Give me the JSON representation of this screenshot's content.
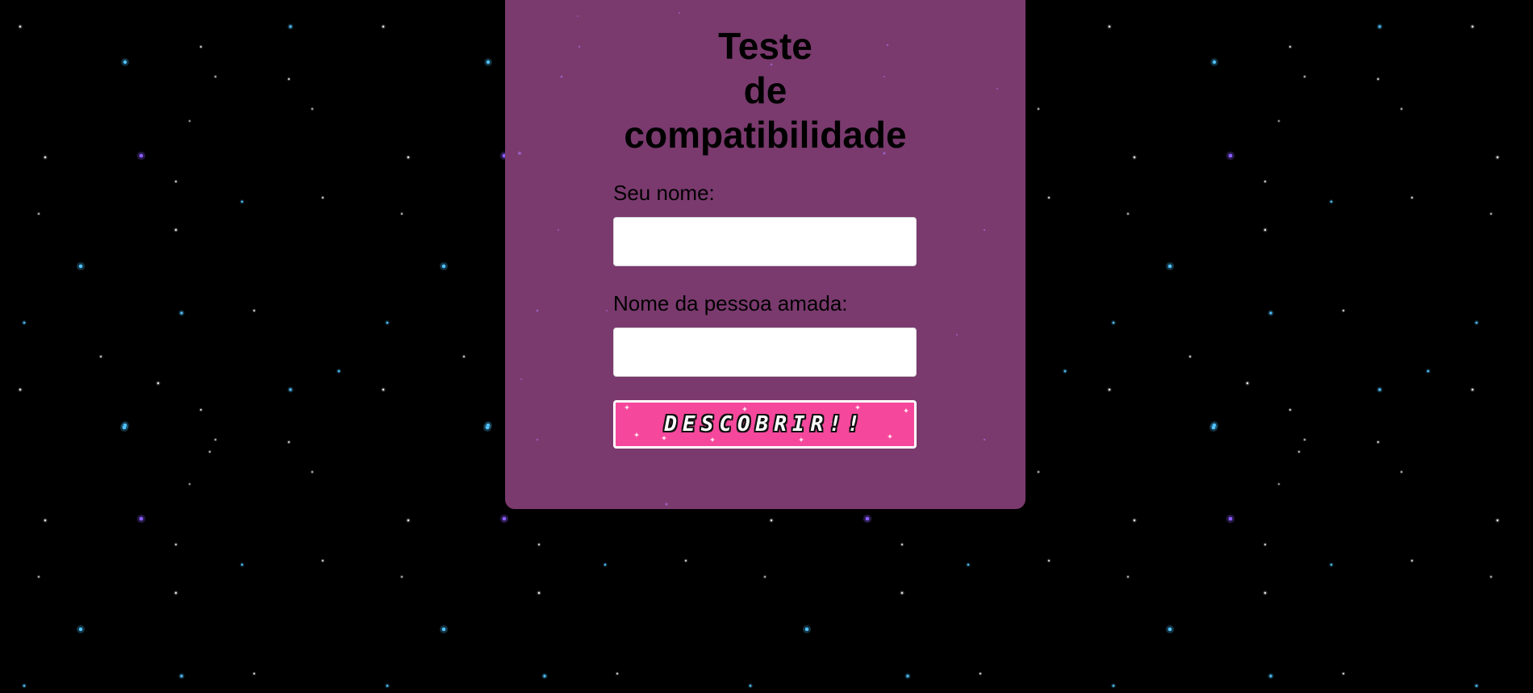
{
  "page": {
    "title_lines": [
      "Teste",
      "de",
      "compatibilidade"
    ]
  },
  "form": {
    "your_name": {
      "label": "Seu nome:",
      "value": "",
      "placeholder": ""
    },
    "loved_name": {
      "label": "Nome da pessoa amada:",
      "value": "",
      "placeholder": ""
    },
    "submit_label": "DESCOBRIR!!"
  },
  "colors": {
    "background": "#000000",
    "card": "#7a3a6e",
    "button": "#f5489c",
    "star_blue": "#4fc3ff",
    "star_purple": "#8a5cff",
    "star_white": "#e8e8e8"
  },
  "icons": {
    "star": "sparkle-star-icon"
  }
}
